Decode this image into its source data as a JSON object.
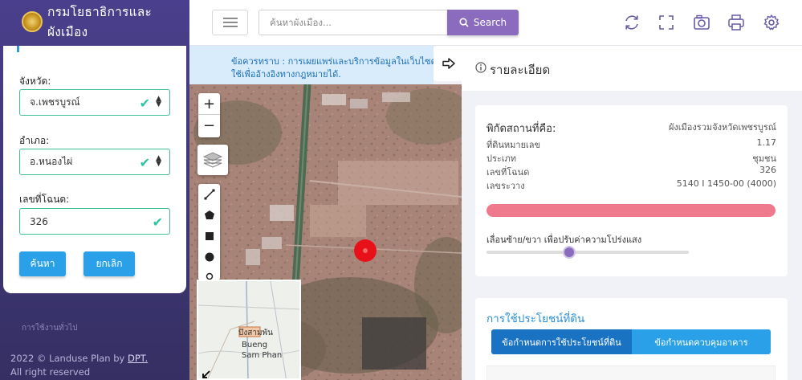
{
  "app": {
    "title": "กรมโยธาธิการและผังเมือง"
  },
  "search_form": {
    "province_label": "จังหวัด:",
    "province_value": "จ.เพชรบูรณ์",
    "district_label": "อำเภอ:",
    "district_value": "อ.หนองไผ่",
    "deed_label": "เลขที่โฉนด:",
    "deed_value": "326",
    "search_button": "ค้นหา",
    "cancel_button": "ยกเลิก"
  },
  "sidebar": {
    "general_link": "การใช้งานทั่วไป",
    "footer_prefix": "2022 © Landuse Plan by ",
    "footer_link": "DPT.",
    "footer_rights": "All right reserved"
  },
  "topbar": {
    "search_placeholder": "ค้นหาผังเมือง...",
    "search_button": "Search",
    "icons": [
      "refresh-icon",
      "fullscreen-icon",
      "camera-icon",
      "print-icon",
      "settings-icon"
    ]
  },
  "notice": {
    "line1": "ข้อควรทราบ : การเผยแพร่และบริการข้อมูลในเว็บไซต์",
    "line2": "ใช้เพื่ออ้างอิงทางกฎหมายได้."
  },
  "map": {
    "zoom_in": "+",
    "zoom_out": "−",
    "minimap_label1": "บึงสามพัน",
    "minimap_label2": "Bueng",
    "minimap_label3": "Sam Phan"
  },
  "detail": {
    "panel_title": "รายละเอียด",
    "location_label": "พิกัดสถานที่คือ:",
    "location_value": "ผังเมืองรวมจังหวัดเพชรบูรณ์",
    "rows": [
      {
        "key": "ที่ดินหมายเลข",
        "value": "1.17"
      },
      {
        "key": "ประเภท",
        "value": "ชุมชน"
      },
      {
        "key": "เลขที่โฉนด",
        "value": "326"
      },
      {
        "key": "เลขระวาง",
        "value": "5140 I 1450-00 (4000)"
      }
    ],
    "slider_label": "เลื่อนซ้าย/ขวา เพื่อปรับค่าความโปร่งแสง",
    "opacity_fraction": 0.41,
    "zone_color": "#ef7a8e"
  },
  "landuse": {
    "title": "การใช้ประโยชน์ที่ดิน",
    "tab_active": "ข้อกำหนดการใช้ประโยชน์ที่ดิน",
    "tab_other": "ข้อกำหนดควบคุมอาคาร"
  },
  "colors": {
    "sidebar": "#3d3673",
    "accent_purple": "#8a6bbd",
    "accent_blue": "#2aa0e8",
    "marker_red": "#e8111a"
  }
}
